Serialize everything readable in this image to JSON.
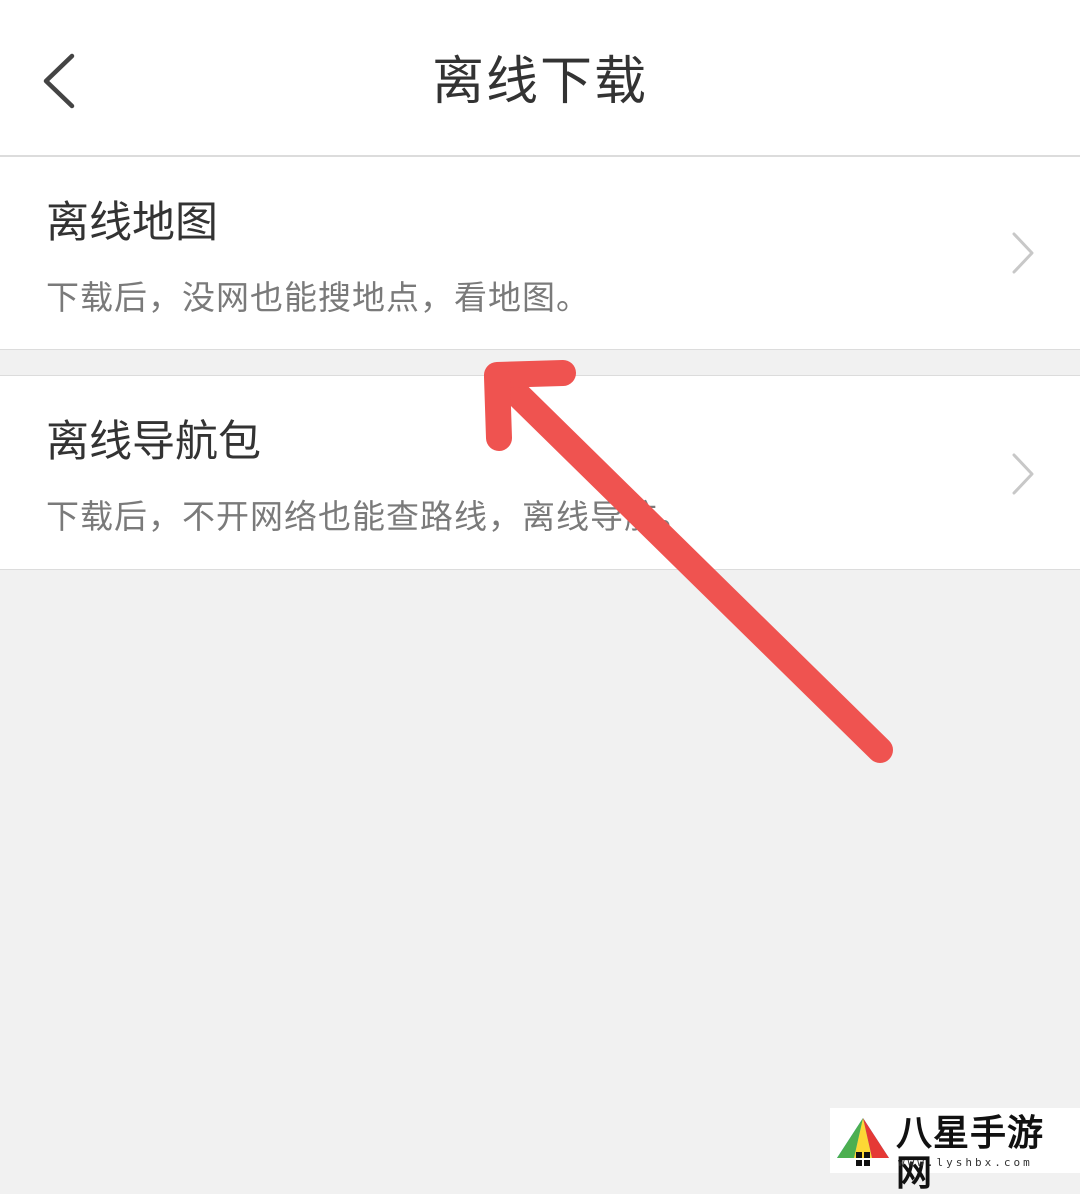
{
  "header": {
    "title": "离线下载",
    "back_icon": "chevron-left-icon"
  },
  "items": [
    {
      "title": "离线地图",
      "description": "下载后，没网也能搜地点，看地图。",
      "chevron_icon": "chevron-right-icon"
    },
    {
      "title": "离线导航包",
      "description": "下载后，不开网络也能查路线，离线导航。",
      "chevron_icon": "chevron-right-icon"
    }
  ],
  "annotation": {
    "arrow_color": "#ef5350"
  },
  "watermark": {
    "text": "八星手游网",
    "url": "www.lyshbx.com"
  },
  "colors": {
    "background": "#f1f1f1",
    "card": "#ffffff",
    "title_text": "#333333",
    "desc_text": "#7a7a7a",
    "divider": "#dcdcdc"
  }
}
